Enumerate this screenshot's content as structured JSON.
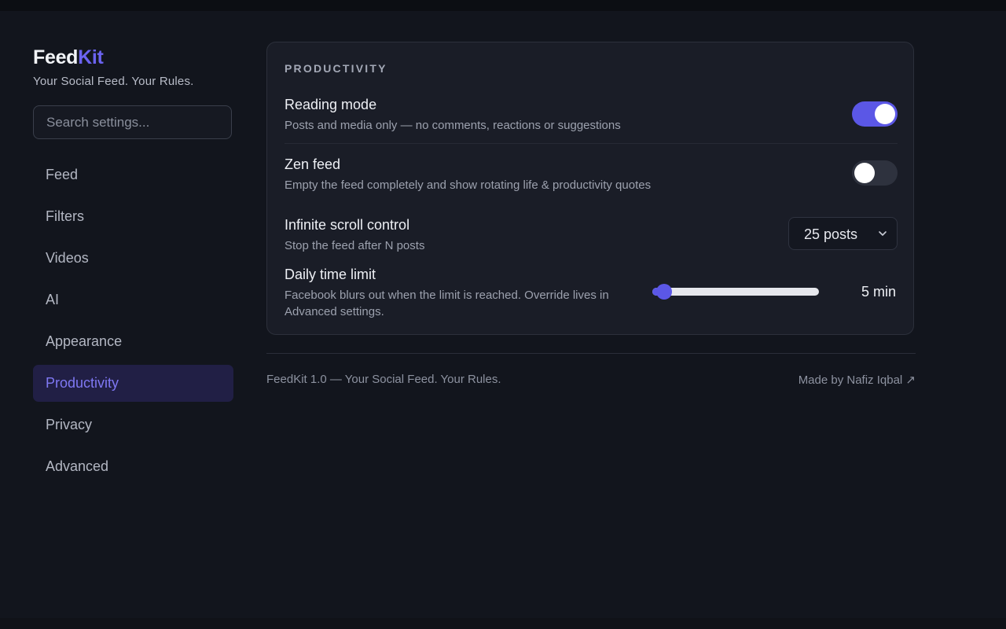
{
  "brand": {
    "name_part1": "Feed",
    "name_part2": "Kit",
    "tagline": "Your Social Feed. Your Rules."
  },
  "search": {
    "placeholder": "Search settings...",
    "value": ""
  },
  "sidebar": {
    "items": [
      {
        "label": "Feed",
        "active": false
      },
      {
        "label": "Filters",
        "active": false
      },
      {
        "label": "Videos",
        "active": false
      },
      {
        "label": "AI",
        "active": false
      },
      {
        "label": "Appearance",
        "active": false
      },
      {
        "label": "Productivity",
        "active": true
      },
      {
        "label": "Privacy",
        "active": false
      },
      {
        "label": "Advanced",
        "active": false
      }
    ]
  },
  "section": {
    "title": "PRODUCTIVITY",
    "settings": {
      "reading_mode": {
        "title": "Reading mode",
        "description": "Posts and media only — no comments, reactions or suggestions",
        "enabled": true
      },
      "zen_feed": {
        "title": "Zen feed",
        "description": "Empty the feed completely and show rotating life & productivity quotes",
        "enabled": false
      },
      "infinite_scroll": {
        "title": "Infinite scroll control",
        "description": "Stop the feed after N posts",
        "selected": "25 posts"
      },
      "daily_limit": {
        "title": "Daily time limit",
        "description": "Facebook blurs out when the limit is reached. Override lives in Advanced settings.",
        "value_label": "5 min",
        "slider_fraction": 0.07
      }
    }
  },
  "footer": {
    "left": "FeedKit 1.0 — Your Social Feed. Your Rules.",
    "right": "Made by Nafiz Iqbal ↗"
  },
  "colors": {
    "accent": "#5b57e6",
    "active_nav_bg": "#211f45",
    "active_nav_text": "#7f78f3",
    "background": "#12151d",
    "card": "#1a1d27"
  },
  "icons": {
    "select_chevron": "chevron-down-icon",
    "external_link": "arrow-up-right"
  }
}
